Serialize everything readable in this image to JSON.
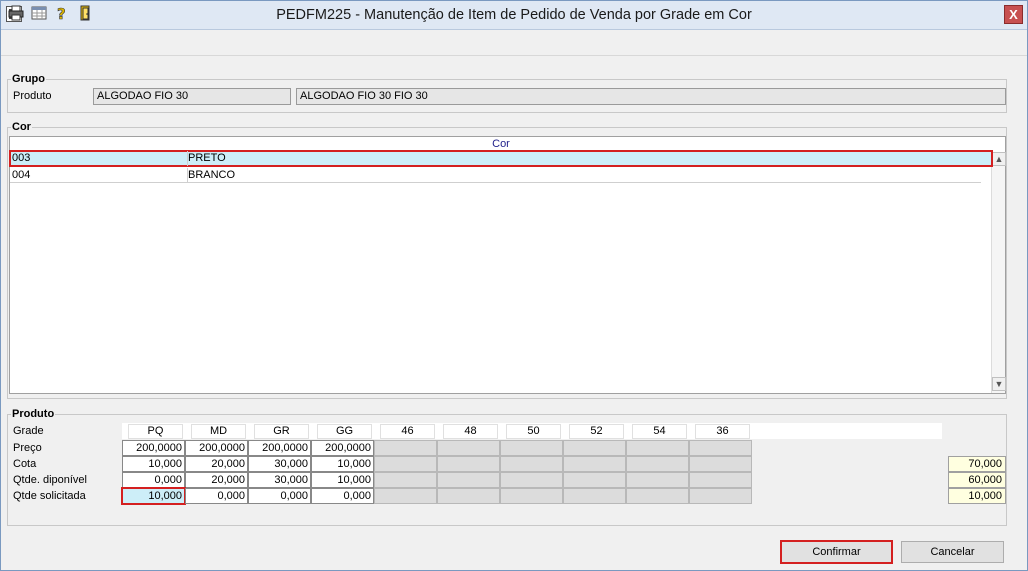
{
  "window": {
    "title": "PEDFM225 - Manutenção de Item de Pedido de Venda por Grade em Cor",
    "close_glyph": "X"
  },
  "toolbar": {
    "icons": [
      "printer-icon",
      "grid-icon",
      "help-icon",
      "exit-door-icon"
    ]
  },
  "grupo": {
    "label": "Grupo",
    "produto_label": "Produto",
    "produto_code": "ALGODAO FIO 30",
    "produto_desc": "ALGODAO FIO 30 FIO 30"
  },
  "cor": {
    "label": "Cor",
    "column_header": "Cor",
    "rows": [
      {
        "code": "003",
        "name": "PRETO"
      },
      {
        "code": "004",
        "name": "BRANCO"
      }
    ]
  },
  "produto": {
    "label": "Produto",
    "row_labels": {
      "grade": "Grade",
      "preco": "Preço",
      "cota": "Cota",
      "qtd_disponivel": "Qtde. diponível",
      "qtd_solicitada": "Qtde solicitada"
    },
    "sizes": [
      "PQ",
      "MD",
      "GR",
      "GG",
      "46",
      "48",
      "50",
      "52",
      "54",
      "36"
    ],
    "preco": [
      "200,0000",
      "200,0000",
      "200,0000",
      "200,0000"
    ],
    "cota": [
      "10,000",
      "20,000",
      "30,000",
      "10,000"
    ],
    "qtd_disponivel": [
      "0,000",
      "20,000",
      "30,000",
      "10,000"
    ],
    "qtd_solicitada": [
      "10,000",
      "0,000",
      "0,000",
      "0,000"
    ],
    "totals": {
      "cota": "70,000",
      "qtd_disponivel": "60,000",
      "qtd_solicitada": "10,000"
    }
  },
  "buttons": {
    "confirmar": "Confirmar",
    "cancelar": "Cancelar"
  }
}
